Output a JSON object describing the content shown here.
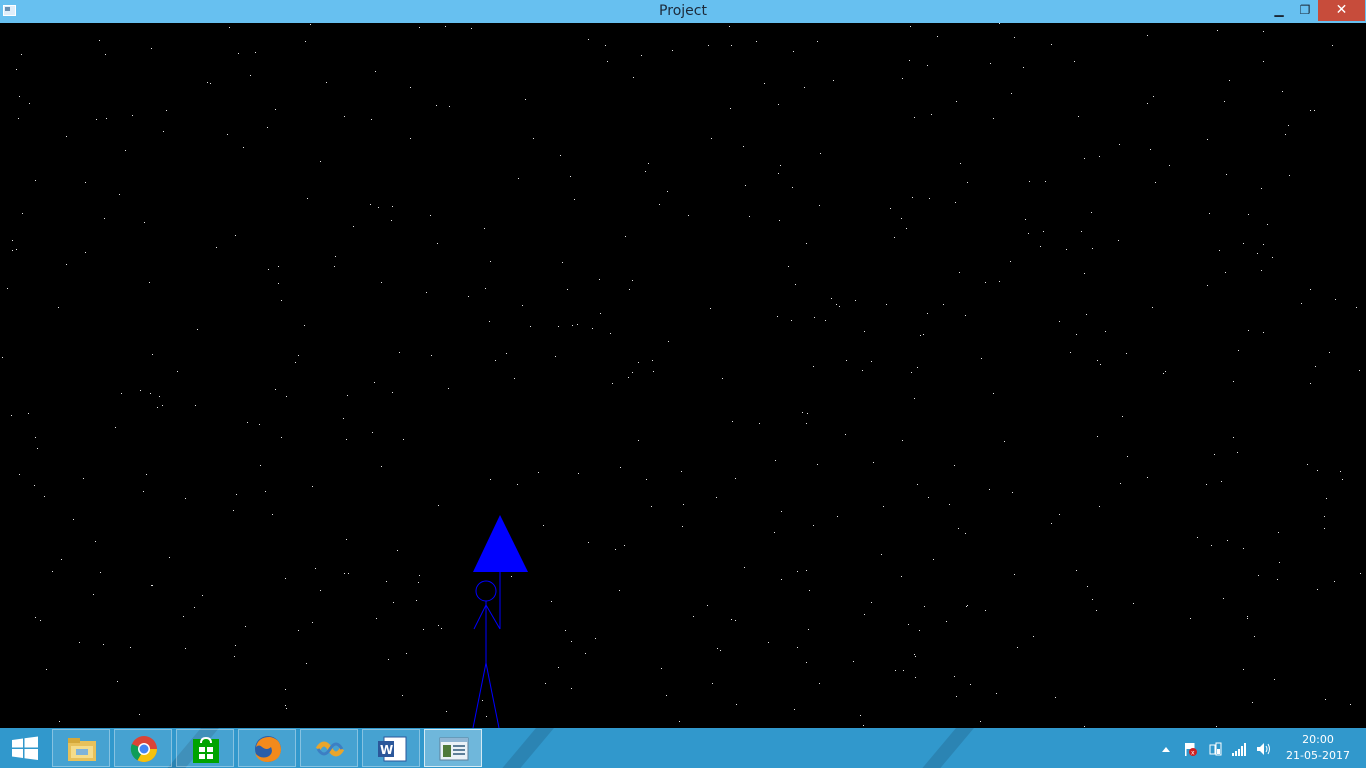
{
  "window": {
    "title": "Project"
  },
  "title_buttons": {
    "minimize": "▁",
    "maximize": "❐",
    "close": "✕"
  },
  "scene": {
    "background": "#000000",
    "figure_color": "#0000ff",
    "star_color": "#e6e6e6"
  },
  "taskbar": {
    "apps": [
      {
        "name": "file-explorer-icon"
      },
      {
        "name": "chrome-icon"
      },
      {
        "name": "store-icon"
      },
      {
        "name": "firefox-icon"
      },
      {
        "name": "ide-icon"
      },
      {
        "name": "word-icon"
      },
      {
        "name": "project-window-icon",
        "active": true
      }
    ],
    "clock": {
      "time": "20:00",
      "date": "21-05-2017"
    }
  }
}
